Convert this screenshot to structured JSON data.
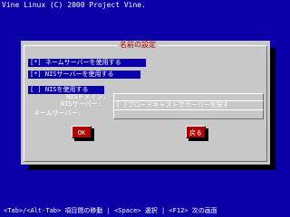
{
  "header": {
    "title": "Vine Linux (C) 2000 Project Vine."
  },
  "dialog": {
    "title": "名前の設定",
    "options": [
      {
        "mark": "[*]",
        "label": "ネームサーバーを使用する"
      },
      {
        "mark": "[*]",
        "label": "NISサーバーを使用する"
      },
      {
        "mark": "[ ]",
        "label": "NISを使用する"
      }
    ],
    "fields": [
      {
        "label": "NISドメイン:",
        "value": ""
      },
      {
        "label": "NISサーバー:",
        "value": "[ ]ブロードキャストでサーバーを探す"
      },
      {
        "label": "ネームサーバー:",
        "value": ""
      }
    ],
    "ok_label": "OK",
    "back_label": "戻る"
  },
  "footer": {
    "hint": "<Tab>/<Alt-Tab> 項目間の移動 | <Space> 選択 | <F12> 次の画面"
  },
  "colors": {
    "background": "#0b00a8",
    "dialog": "#c8c8c8",
    "button": "#b00000"
  }
}
